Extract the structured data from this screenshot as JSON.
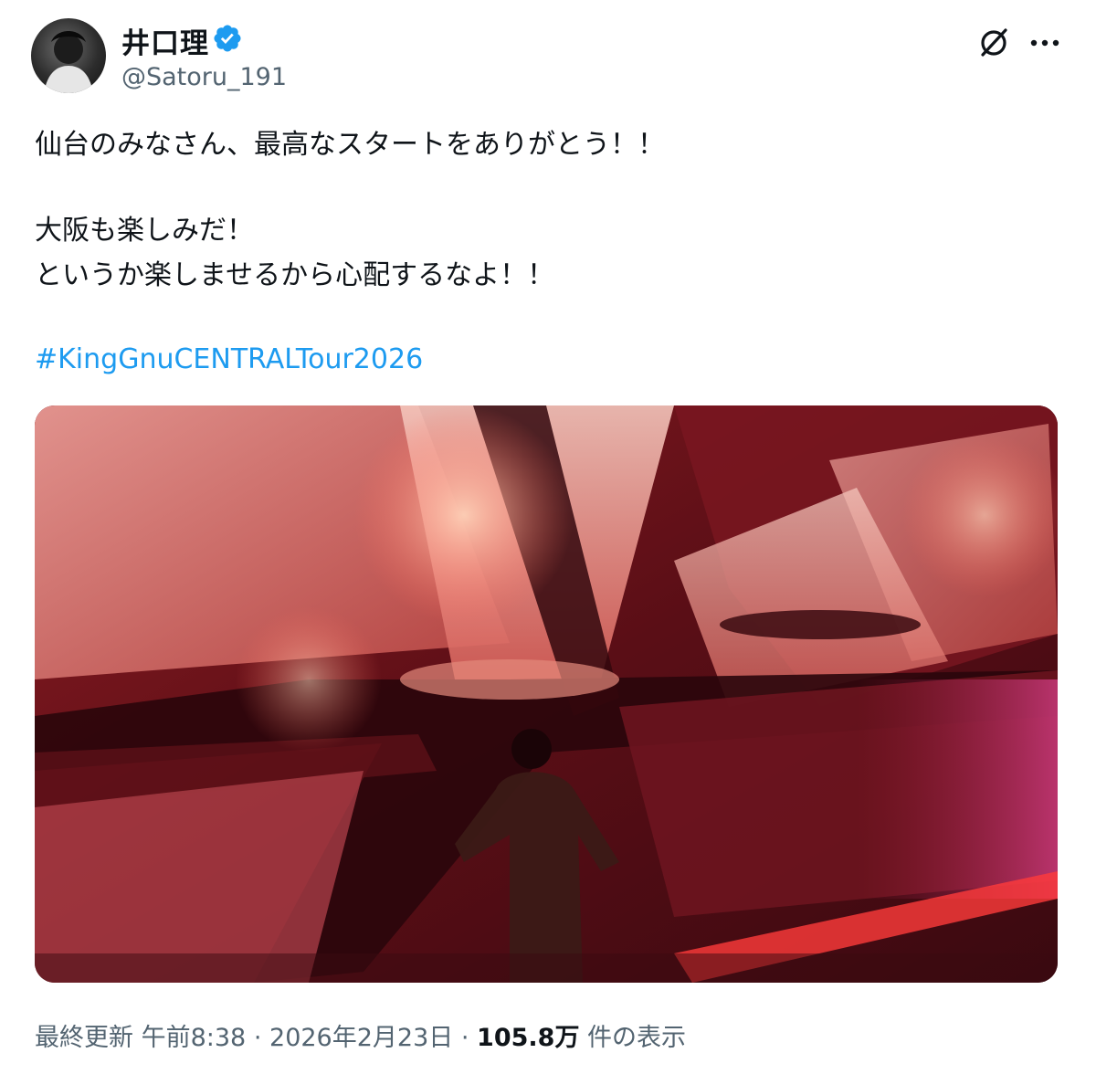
{
  "author": {
    "name": "井口理",
    "handle": "@Satoru_191",
    "verified_color": "#1d9bf0"
  },
  "icons": {
    "verified": "verified-badge-icon",
    "grok": "grok-icon",
    "more": "more-options-icon"
  },
  "tweet": {
    "lines": [
      "仙台のみなさん、最高なスタートをありがとう！！",
      "大阪も楽しみだ！",
      "というか楽しませるから心配するなよ！！"
    ],
    "hashtag": "#KingGnuCENTRALTour2026",
    "link_color": "#1d9bf0"
  },
  "meta": {
    "updated_label": "最終更新",
    "time": "午前8:38",
    "separator": "·",
    "date": "2026年2月23日",
    "views": "105.8万",
    "views_label": "件の表示"
  }
}
